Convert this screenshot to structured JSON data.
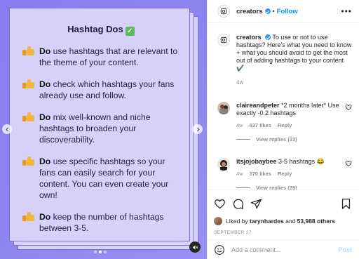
{
  "card": {
    "title": "Hashtag Dos",
    "title_emoji": "✅",
    "tips": [
      {
        "bold": "Do",
        "text": " use hashtags that are relevant to the theme of your content."
      },
      {
        "bold": "Do",
        "text": " check which hashtags your fans already use and follow."
      },
      {
        "bold": "Do",
        "text": " mix well-known and niche hashtags to broaden your discoverability."
      },
      {
        "bold": "Do",
        "text": " use specific hashtags so your fans can easily search for your content. You can even create your own!"
      },
      {
        "bold": "Do",
        "text": " keep the number of hashtags between 3-5."
      }
    ],
    "tip_icon": "thumbs-up-icon"
  },
  "carousel": {
    "slide_count": 3,
    "active_index": 1
  },
  "header": {
    "username": "creators",
    "separator": "•",
    "follow_label": "Follow",
    "more_label": "•••"
  },
  "caption": {
    "username": "creators",
    "text": "To use or not to use hashtags? Here's what you need to know + what you should avoid to get the most out of adding hashtags to your content ✔️",
    "age": "4w"
  },
  "comments": [
    {
      "username": "claireandpeter",
      "text": "*2 months later* Use exactly -0.2 hashtags",
      "age": "4w",
      "likes": "637 likes",
      "reply_label": "Reply",
      "view_replies": "View replies (33)"
    },
    {
      "username": "itsjojobaybee",
      "text": "3-5 hashtags 😂",
      "age": "4w",
      "likes": "370 likes",
      "reply_label": "Reply",
      "view_replies": "View replies (29)"
    }
  ],
  "likes": {
    "prefix": "Liked by ",
    "user": "tarynhardes",
    "middle": " and ",
    "count": "53,988 others"
  },
  "date": "SEPTEMBER 27",
  "add_comment": {
    "placeholder": "Add a comment...",
    "post_label": "Post"
  },
  "colors": {
    "accent": "#0095f6",
    "card_bg": "#d6d0fb",
    "media_bg": "#8a7bf0"
  }
}
